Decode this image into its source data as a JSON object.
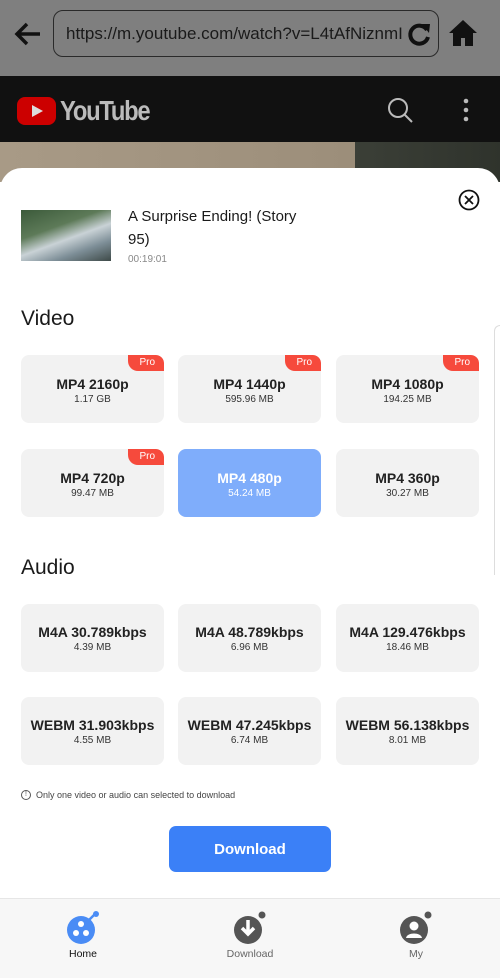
{
  "browser": {
    "url": "https://m.youtube.com/watch?v=L4tAfNiznmI"
  },
  "youtube": {
    "logo_text": "YouTube"
  },
  "video": {
    "title": "A Surprise Ending! (Story 95)",
    "duration": "00:19:01"
  },
  "sections": {
    "video": "Video",
    "audio": "Audio"
  },
  "pro_label": "Pro",
  "video_formats": [
    {
      "name": "MP4 2160p",
      "size": "1.17 GB",
      "pro": true
    },
    {
      "name": "MP4 1440p",
      "size": "595.96 MB",
      "pro": true
    },
    {
      "name": "MP4 1080p",
      "size": "194.25 MB",
      "pro": true
    },
    {
      "name": "MP4 720p",
      "size": "99.47 MB",
      "pro": true
    },
    {
      "name": "MP4 480p",
      "size": "54.24 MB",
      "pro": false,
      "selected": true
    },
    {
      "name": "MP4 360p",
      "size": "30.27 MB",
      "pro": false
    }
  ],
  "audio_formats": [
    {
      "name": "M4A 30.789kbps",
      "size": "4.39 MB"
    },
    {
      "name": "M4A 48.789kbps",
      "size": "6.96 MB"
    },
    {
      "name": "M4A 129.476kbps",
      "size": "18.46 MB"
    },
    {
      "name": "WEBM 31.903kbps",
      "size": "4.55 MB"
    },
    {
      "name": "WEBM 47.245kbps",
      "size": "6.74 MB"
    },
    {
      "name": "WEBM 56.138kbps",
      "size": "8.01 MB"
    }
  ],
  "note": "Only one video or audio can selected to download",
  "download_button": "Download",
  "nav": [
    {
      "label": "Home",
      "icon": "home-reel-icon",
      "active": true
    },
    {
      "label": "Download",
      "icon": "download-icon"
    },
    {
      "label": "My",
      "icon": "user-icon"
    }
  ],
  "colors": {
    "accent": "#3b80f7",
    "selected": "#7fadfb",
    "pro": "#f64a3c"
  }
}
